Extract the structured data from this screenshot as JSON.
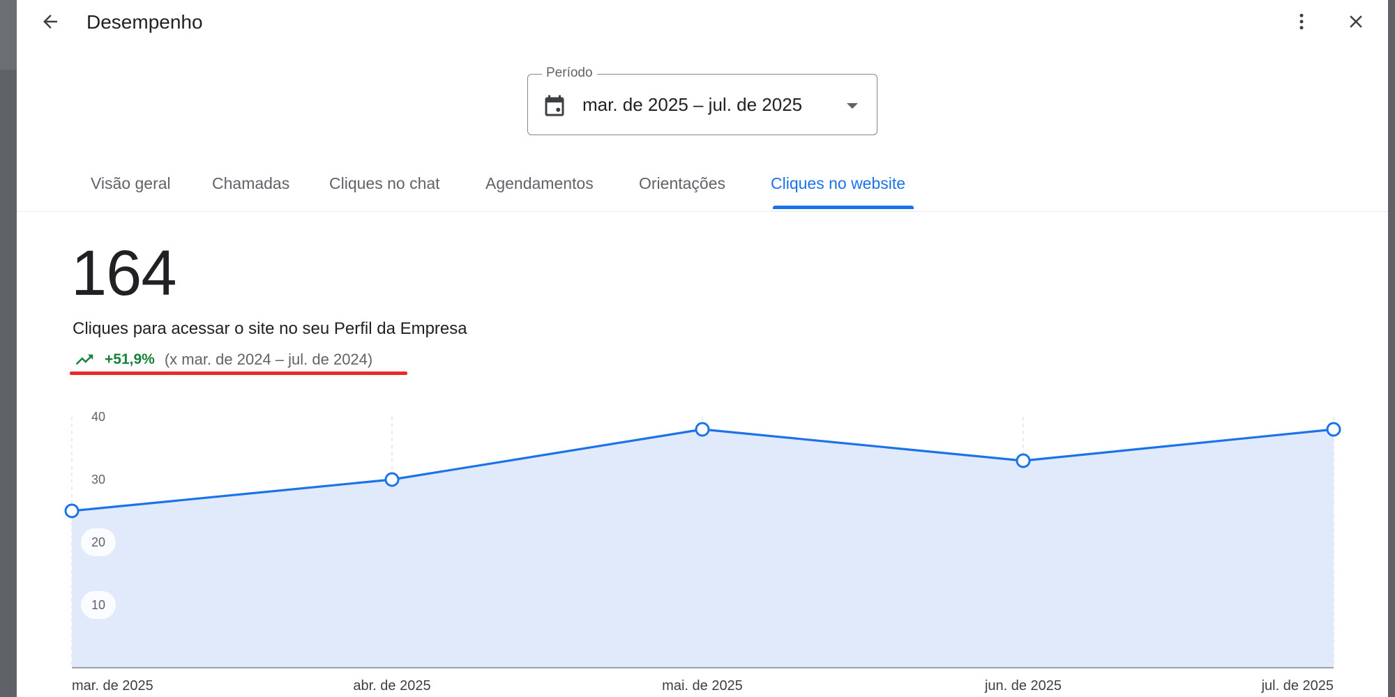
{
  "header": {
    "title": "Desempenho",
    "back_icon": "arrow-back-icon",
    "more_icon": "more-vert-icon",
    "close_icon": "close-icon"
  },
  "period": {
    "label": "Período",
    "value": "mar. de 2025 – jul. de 2025",
    "calendar_icon": "calendar-icon",
    "dropdown_icon": "arrow-drop-down-icon"
  },
  "tabs": [
    {
      "label": "Visão geral",
      "active": false
    },
    {
      "label": "Chamadas",
      "active": false
    },
    {
      "label": "Cliques no chat",
      "active": false
    },
    {
      "label": "Agendamentos",
      "active": false
    },
    {
      "label": "Orientações",
      "active": false
    },
    {
      "label": "Cliques no website",
      "active": true
    }
  ],
  "metric": {
    "value": "164",
    "description": "Cliques para acessar o site no seu Perfil da Empresa",
    "trend_icon": "trending-up-icon",
    "trend_percent": "+51,9%",
    "comparison": "(x mar. de 2024 – jul. de 2024)"
  },
  "colors": {
    "accent": "#1a73e8",
    "positive": "#188038",
    "highlight_underline": "#ea2a2a",
    "area_fill": "#e1eafb"
  },
  "chart_data": {
    "type": "area",
    "categories": [
      "mar. de 2025",
      "abr. de 2025",
      "mai. de 2025",
      "jun. de 2025",
      "jul. de 2025"
    ],
    "values": [
      25,
      30,
      38,
      33,
      38
    ],
    "yticks": [
      "40",
      "30",
      "20",
      "10"
    ],
    "ylim": [
      0,
      40
    ],
    "grid": "vertical-dashed",
    "title": "",
    "xlabel": "",
    "ylabel": ""
  }
}
